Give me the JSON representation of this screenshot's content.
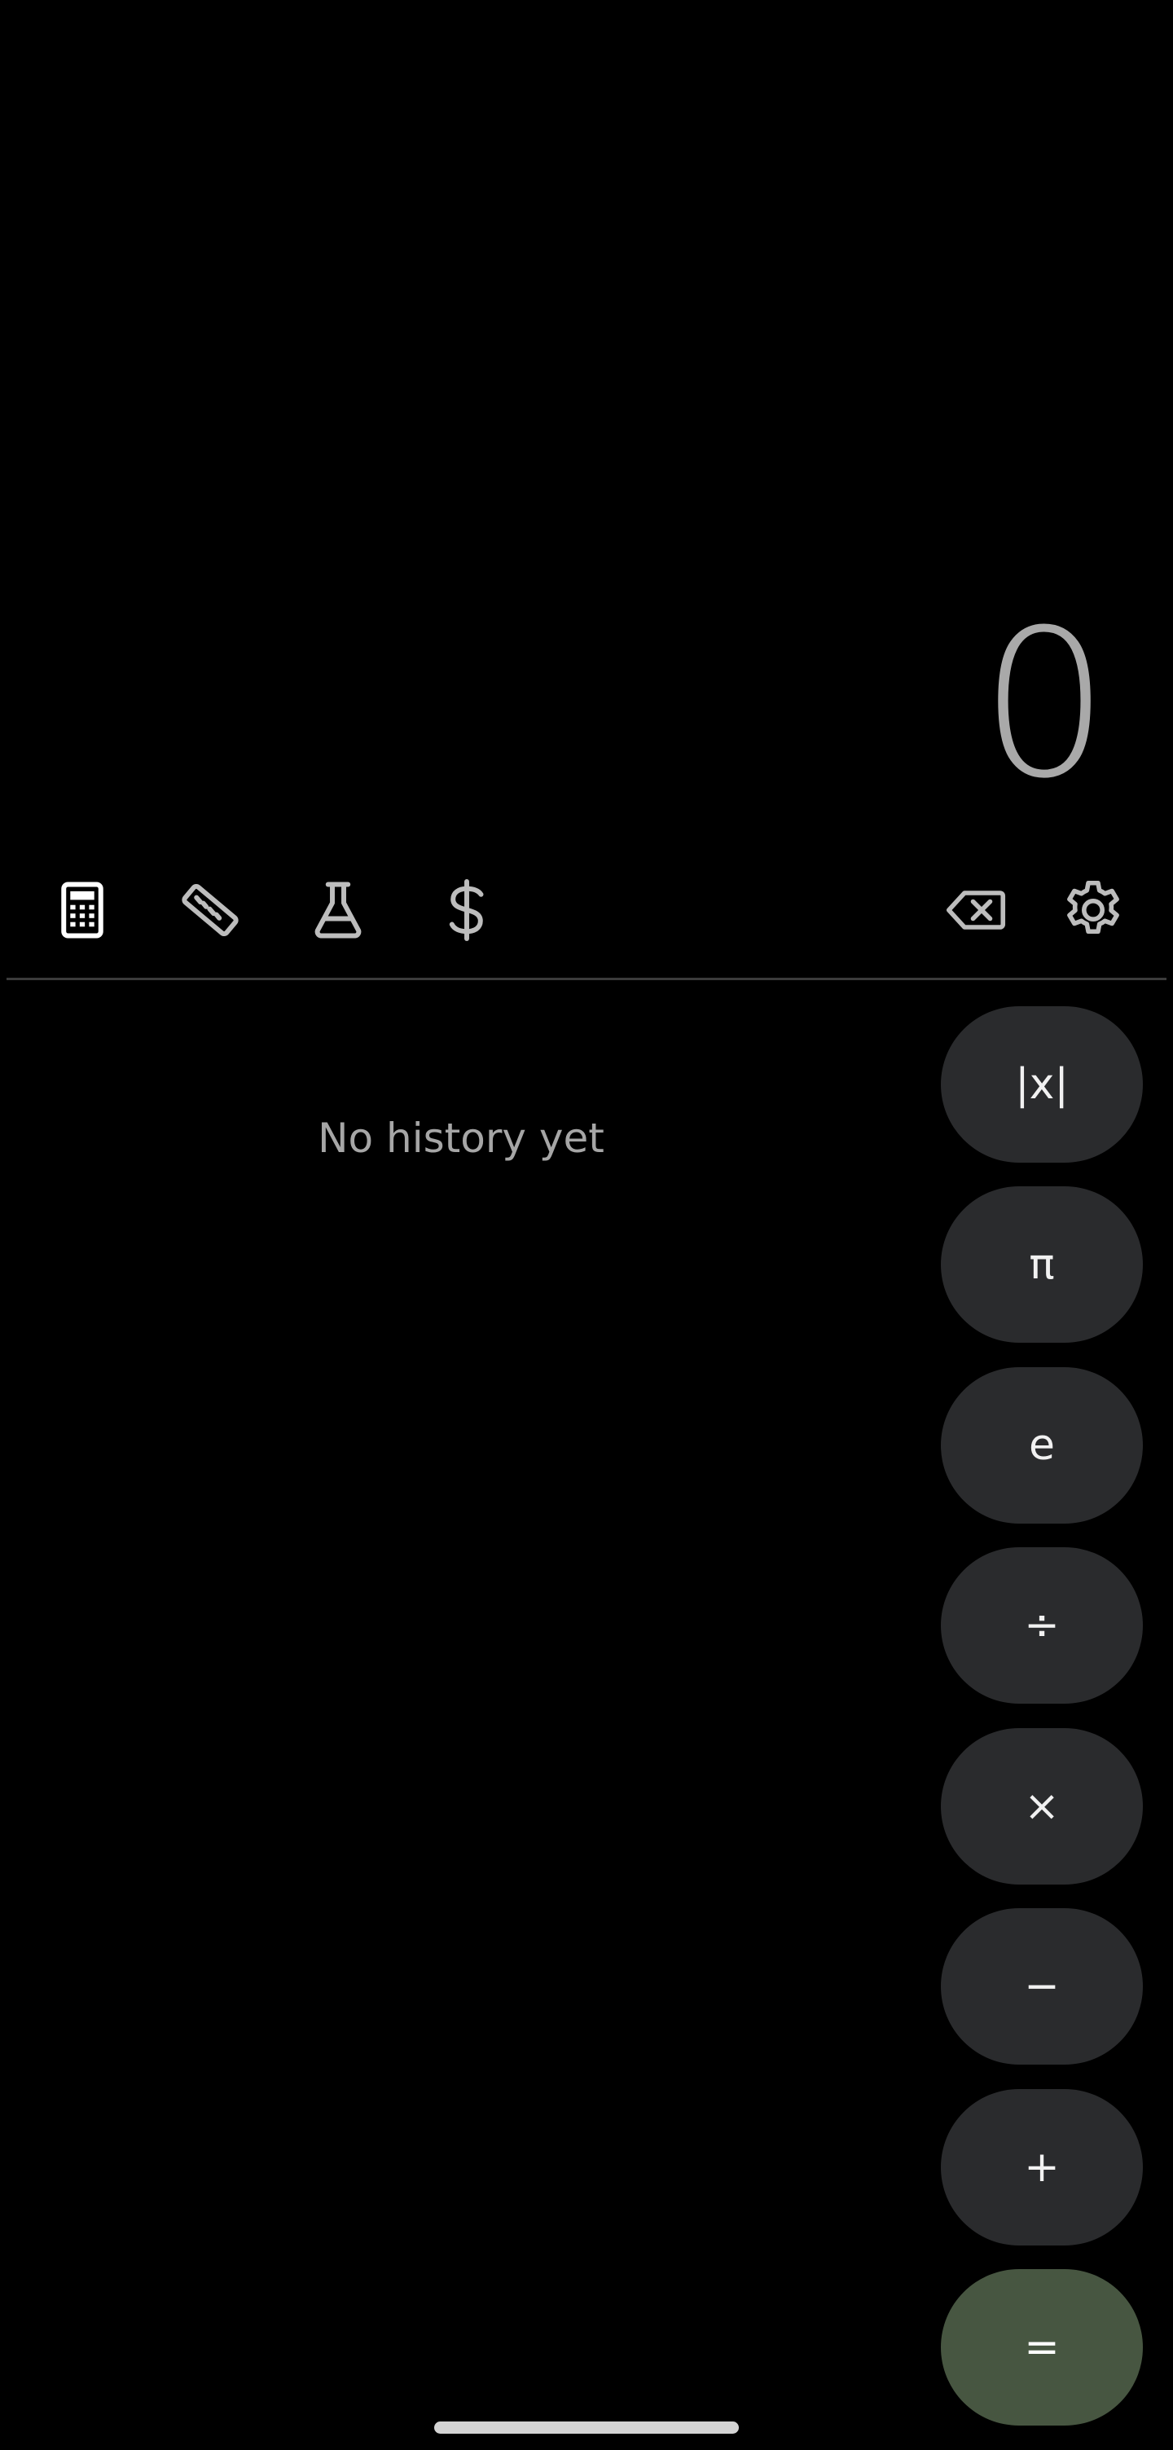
{
  "display": {
    "value": "0",
    "color": "#a9a9a9"
  },
  "toolbar": {
    "modes": [
      {
        "name": "calculator-icon",
        "active": true
      },
      {
        "name": "ruler-icon",
        "active": false
      },
      {
        "name": "flask-icon",
        "active": false
      },
      {
        "name": "dollar-icon",
        "active": false
      }
    ],
    "actions": [
      {
        "name": "backspace-icon"
      },
      {
        "name": "gear-icon"
      }
    ],
    "icon_color_active": "#ffffff",
    "icon_color_inactive": "#bdbdbd"
  },
  "history": {
    "empty_text": "No history yet"
  },
  "keys": {
    "abs": "|x|",
    "pi": "π",
    "e": "e",
    "divide": "÷",
    "multiply": "×",
    "minus": "−",
    "plus": "+",
    "equals": "="
  },
  "colors": {
    "background": "#000000",
    "key_background": "#2a2b2d",
    "equals_background": "#475641",
    "divider": "#3b3b3b"
  }
}
